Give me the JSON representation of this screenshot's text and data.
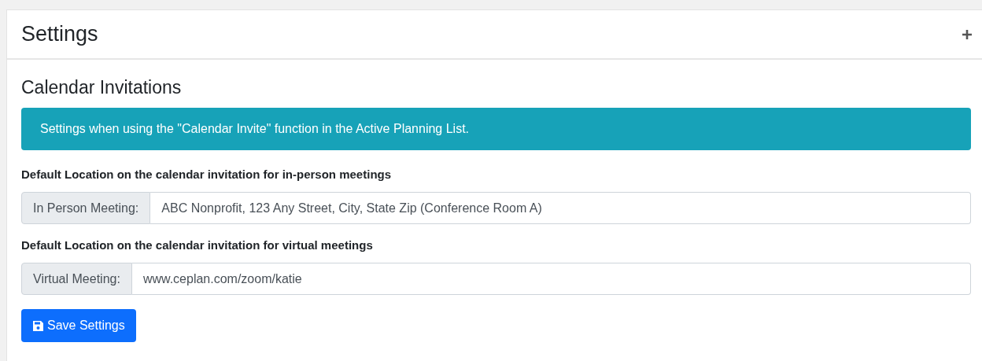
{
  "panel": {
    "title": "Settings"
  },
  "section": {
    "heading": "Calendar Invitations",
    "info": "Settings when using the \"Calendar Invite\" function in the Active Planning List."
  },
  "fields": [
    {
      "label": "Default Location on the calendar invitation for in-person meetings",
      "prefix": "In Person Meeting:",
      "value": "ABC Nonprofit, 123 Any Street, City, State Zip (Conference Room A)"
    },
    {
      "label": "Default Location on the calendar invitation for virtual meetings",
      "prefix": "Virtual Meeting:",
      "value": "www.ceplan.com/zoom/katie"
    }
  ],
  "save_button": {
    "label": "Save Settings"
  }
}
